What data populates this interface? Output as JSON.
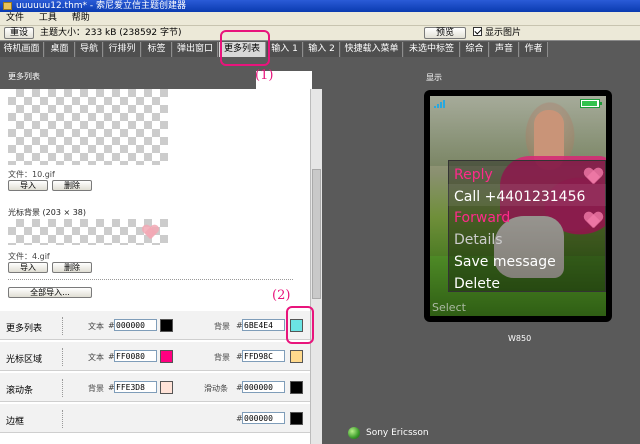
{
  "window": {
    "title": "uuuuuu12.thm* - 索尼爱立信主题创建器"
  },
  "menu": [
    "文件",
    "工具",
    "帮助"
  ],
  "infobar": {
    "reset_label": "重设",
    "theme_size": "主题大小：233 kB (238592 字节)",
    "preview_label": "预览",
    "show_images_label": "显示图片"
  },
  "tabs": [
    "待机画面",
    "桌面",
    "导航",
    "行排列",
    "标签",
    "弹出窗口",
    "更多列表",
    "输入 1",
    "输入 2",
    "快捷载入菜单",
    "未选中标签",
    "综合",
    "声音",
    "作者"
  ],
  "panel": {
    "title": "更多列表",
    "image1": {
      "file": "文件：10.gif",
      "import": "导入",
      "delete": "删除"
    },
    "cursor_bg": {
      "label": "光标背景 (203 × 38)",
      "file": "文件：4.gif",
      "import": "导入",
      "delete": "删除"
    },
    "import_all": "全部导入..."
  },
  "settings": [
    {
      "label": "更多列表",
      "f1": "文本",
      "v1": "000000",
      "c1": "#000000",
      "f2": "背景",
      "v2": "6BE4E4",
      "c2": "#6be4e4"
    },
    {
      "label": "光标区域",
      "f1": "文本",
      "v1": "FF0080",
      "c1": "#ff0080",
      "f2": "背景",
      "v2": "FFD98C",
      "c2": "#ffd98c"
    },
    {
      "label": "滚动条",
      "f1": "背景",
      "v1": "FFE3D8",
      "c1": "#ffe3d8",
      "f2": "滑动条",
      "v2": "000000",
      "c2": "#000000"
    },
    {
      "label": "边框",
      "f2": "",
      "v2": "000000",
      "c2": "#000000"
    }
  ],
  "preview": {
    "display_label": "显示",
    "menu_items": [
      {
        "text": "Reply",
        "color": "#ff2a8a"
      },
      {
        "text": "Call +4401231456",
        "color": "#ffffff"
      },
      {
        "text": "Forward",
        "color": "#ff2a8a"
      },
      {
        "text": "Details",
        "color": "#cccccc"
      },
      {
        "text": "Save message",
        "color": "#ffffff"
      },
      {
        "text": "Delete",
        "color": "#ffffff"
      }
    ],
    "softkey": "Select",
    "model": "W850",
    "brand": "Sony Ericsson"
  },
  "annotations": {
    "a1": "(1)",
    "a2": "(2)"
  },
  "colors": {
    "annotation": "#e8147c",
    "tab_bg": "#4f4f4f",
    "active_tab_bg": "#d8d8d8"
  }
}
